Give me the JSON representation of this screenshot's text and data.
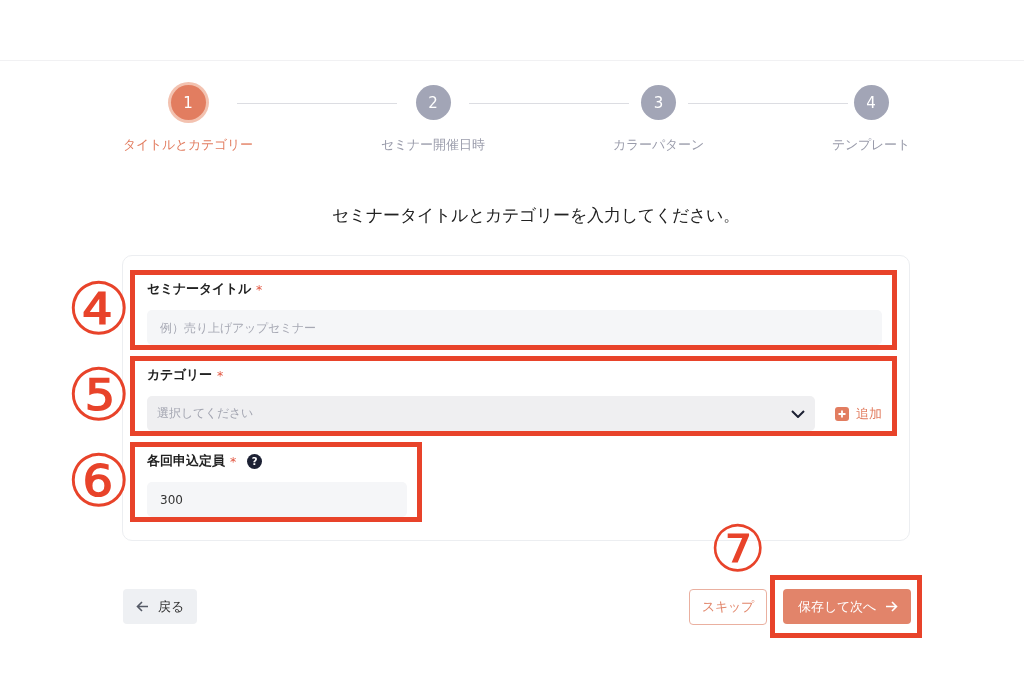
{
  "steps": [
    {
      "number": "1",
      "label": "タイトルとカテゴリー",
      "selected": true
    },
    {
      "number": "2",
      "label": "セミナー開催日時",
      "selected": false
    },
    {
      "number": "3",
      "label": "カラーパターン",
      "selected": false
    },
    {
      "number": "4",
      "label": "テンプレート",
      "selected": false
    }
  ],
  "heading": "セミナータイトルとカテゴリーを入力してください。",
  "fields": [
    {
      "kind": "text",
      "label": "セミナータイトル",
      "required_mark": "*",
      "placeholder": "例）売り上げアップセミナー",
      "highlighted": true,
      "marker": "④"
    },
    {
      "kind": "select",
      "label": "カテゴリー",
      "required_mark": "*",
      "placeholder": "選択してください",
      "add_button": "追加",
      "highlighted": true,
      "marker": "⑤"
    },
    {
      "kind": "number",
      "label": "各回申込定員",
      "required_mark": "*",
      "help": "?",
      "value": "300",
      "highlighted": true,
      "marker": "⑥"
    }
  ],
  "actions": {
    "back": "戻る",
    "skip": "スキップ",
    "save": "保存して次へ",
    "save_highlighted": true,
    "marker": "⑦"
  }
}
